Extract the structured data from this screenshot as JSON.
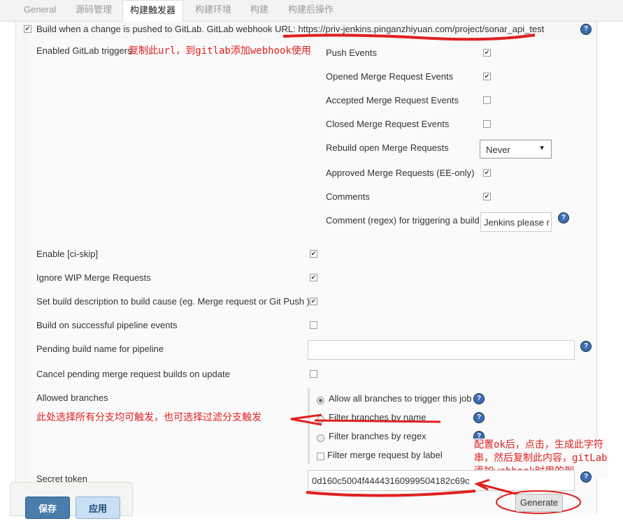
{
  "tabs": [
    "General",
    "源码管理",
    "构建触发器",
    "构建环境",
    "构建",
    "构建后操作"
  ],
  "active_tab": "构建触发器",
  "trigger": {
    "label": "Build when a change is pushed to GitLab. GitLab webhook URL: ",
    "url": "https://priv-jenkins.pinganzhiyuan.com/project/sonar_api_test",
    "checked": true
  },
  "enabled_triggers_label": "Enabled GitLab triggers",
  "annot_url": "复制此url，到gitlab添加webhook使用",
  "events": [
    {
      "label": "Push Events",
      "checked": true
    },
    {
      "label": "Opened Merge Request Events",
      "checked": true
    },
    {
      "label": "Accepted Merge Request Events",
      "checked": false
    },
    {
      "label": "Closed Merge Request Events",
      "checked": false
    }
  ],
  "rebuild": {
    "label": "Rebuild open Merge Requests",
    "value": "Never"
  },
  "events2": [
    {
      "label": "Approved Merge Requests (EE-only)",
      "checked": true
    },
    {
      "label": "Comments",
      "checked": true
    }
  ],
  "comment_regex": {
    "label": "Comment (regex) for triggering a build",
    "value": "Jenkins please r"
  },
  "options": [
    {
      "label": "Enable [ci-skip]",
      "checked": true
    },
    {
      "label": "Ignore WIP Merge Requests",
      "checked": true
    },
    {
      "label": "Set build description to build cause (eg. Merge request or Git Push )",
      "checked": true
    },
    {
      "label": "Build on successful pipeline events",
      "checked": false
    }
  ],
  "pending_name": {
    "label": "Pending build name for pipeline",
    "value": ""
  },
  "cancel_pending": {
    "label": "Cancel pending merge request builds on update",
    "checked": false
  },
  "allowed_branches": {
    "label": "Allowed branches",
    "choices": [
      "Allow all branches to trigger this job",
      "Filter branches by name",
      "Filter branches by regex"
    ],
    "selected": 0,
    "label_filter": "Filter merge request by label"
  },
  "annot_branches": "此处选择所有分支均可触发，也可选择过滤分支触发",
  "secret_token": {
    "label": "Secret token",
    "value": "0d160c5004f44443160999504182c69c"
  },
  "annot_token": [
    "配置ok后，点击，生成此字符",
    "串，然后复制此内容，gitLab",
    "添加webhook时用的到"
  ],
  "generate_label": "Generate",
  "save_label": "保存",
  "apply_label": "应用",
  "colors": {
    "annotation": "#e02020",
    "save": "#4a7dac",
    "apply": "#c9dff2"
  }
}
